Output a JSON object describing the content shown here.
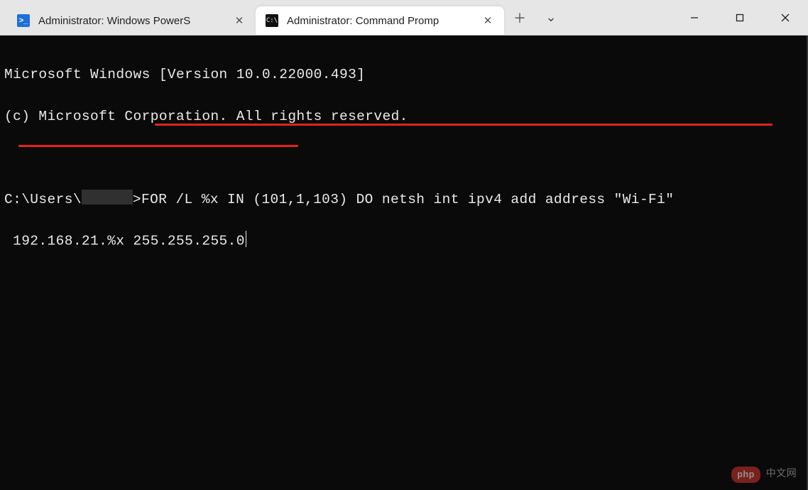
{
  "tabs": [
    {
      "label": "Administrator: Windows PowerS",
      "icon_text": ">_",
      "active": false
    },
    {
      "label": "Administrator: Command Promp",
      "icon_text": "C:\\",
      "active": true
    }
  ],
  "terminal": {
    "line1": "Microsoft Windows [Version 10.0.22000.493]",
    "line2": "(c) Microsoft Corporation. All rights reserved.",
    "prompt_prefix": "C:\\Users\\",
    "prompt_suffix": ">",
    "command_part1": "FOR /L %x IN (101,1,103) DO netsh int ipv4 add address \"Wi-Fi\"",
    "command_part2": " 192.168.21.%x 255.255.255.0"
  },
  "watermark": {
    "pill": "php",
    "text": "中文网"
  },
  "icons": {
    "close_glyph": "✕",
    "plus_glyph": "＋",
    "chevron_glyph": "⌄"
  }
}
